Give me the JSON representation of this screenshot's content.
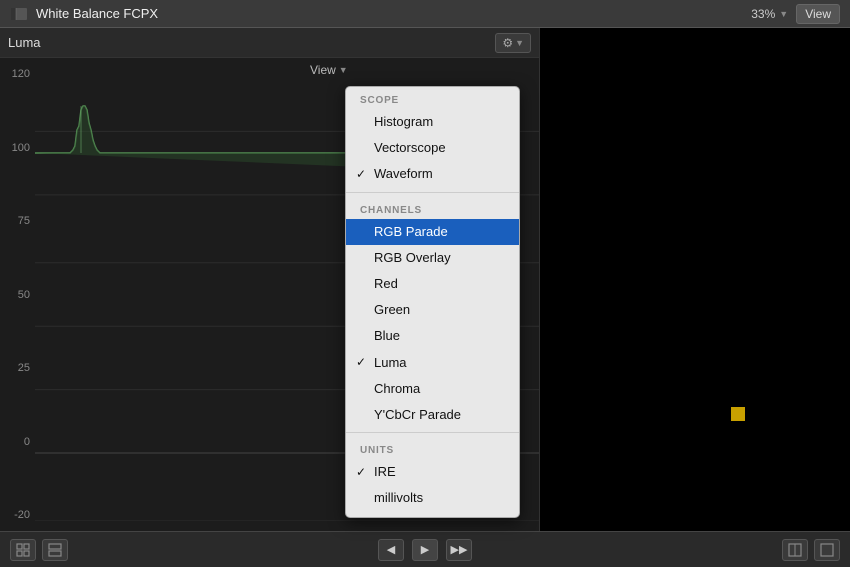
{
  "titlebar": {
    "title": "White Balance FCPX",
    "zoom": "33%",
    "view_label": "View"
  },
  "waveform_panel": {
    "label": "Luma",
    "view_label": "View",
    "y_axis": [
      "120",
      "100",
      "75",
      "50",
      "25",
      "0",
      "-20"
    ]
  },
  "dropdown": {
    "scope_header": "SCOPE",
    "channels_header": "CHANNELS",
    "units_header": "UNITS",
    "items": {
      "scope": [
        {
          "label": "Histogram",
          "checked": false
        },
        {
          "label": "Vectorscope",
          "checked": false
        },
        {
          "label": "Waveform",
          "checked": true
        }
      ],
      "channels": [
        {
          "label": "RGB Parade",
          "checked": false,
          "active": true
        },
        {
          "label": "RGB Overlay",
          "checked": false
        },
        {
          "label": "Red",
          "checked": false
        },
        {
          "label": "Green",
          "checked": false
        },
        {
          "label": "Blue",
          "checked": false
        },
        {
          "label": "Luma",
          "checked": true
        },
        {
          "label": "Chroma",
          "checked": false
        },
        {
          "label": "Y'CbCr Parade",
          "checked": false
        }
      ],
      "units": [
        {
          "label": "IRE",
          "checked": true
        },
        {
          "label": "millivolts",
          "checked": false
        }
      ]
    }
  },
  "toolbar": {
    "left_btn1": "⊞",
    "left_btn2": "⊟",
    "play_back": "◀",
    "play": "▶",
    "play_fwd": "▶▶",
    "right_btn1": "⊞",
    "right_btn2": "⊟"
  },
  "icons": {
    "gear": "⚙",
    "dropdown_arrow": "▼",
    "film": "🎬"
  }
}
